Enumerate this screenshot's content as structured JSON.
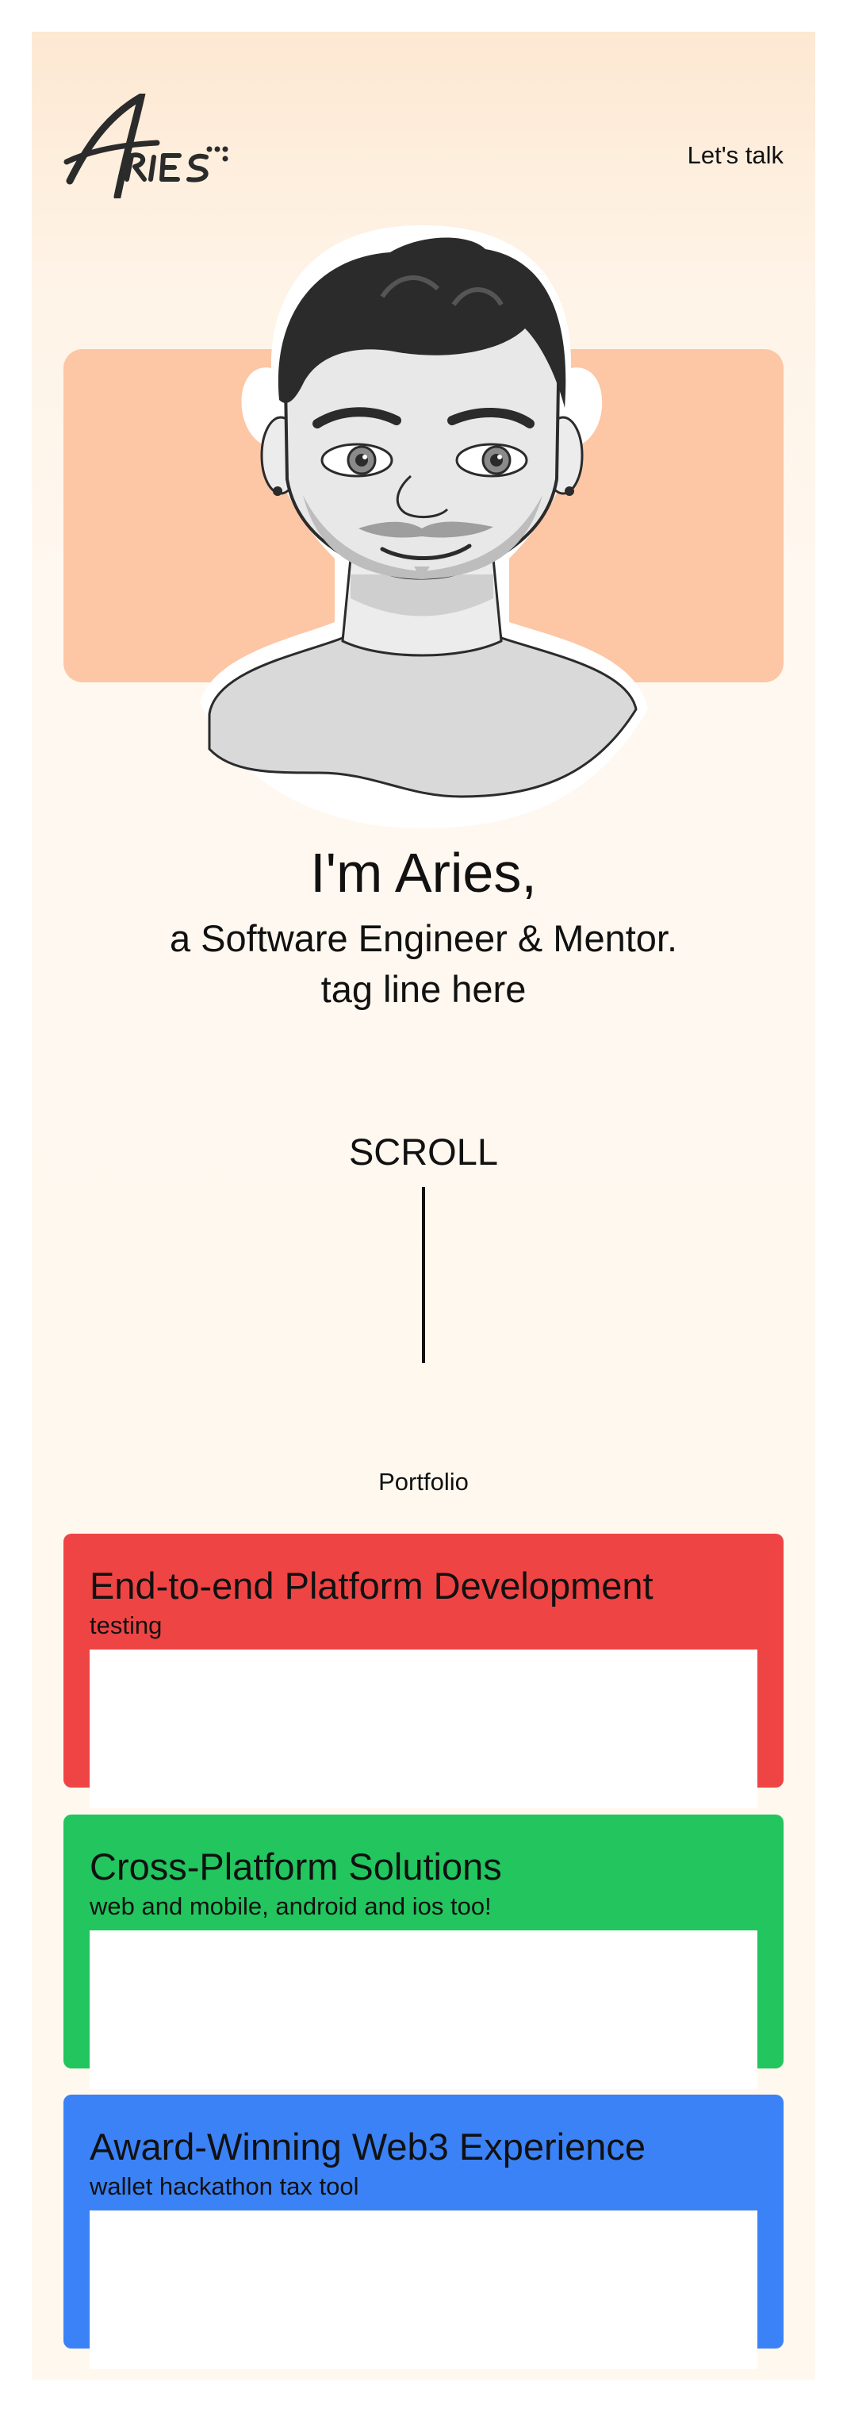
{
  "header": {
    "logo_text": "Aries",
    "cta_label": "Let's talk"
  },
  "hero": {
    "title": "I'm Aries,",
    "subtitle": "a Software Engineer & Mentor.",
    "tagline": "tag line here",
    "scroll_label": "SCROLL"
  },
  "portfolio": {
    "heading": "Portfolio",
    "cards": [
      {
        "title": "End-to-end Platform Development",
        "description": "testing",
        "color": "#ef4444"
      },
      {
        "title": "Cross-Platform Solutions",
        "description": "web and mobile, android and ios too!",
        "color": "#22c55e"
      },
      {
        "title": "Award-Winning Web3 Experience",
        "description": "wallet hackathon tax tool",
        "color": "#3b82f6"
      }
    ]
  },
  "colors": {
    "hero_accent": "#fdc6a4",
    "page_background_top": "#fde8d2",
    "page_background_bottom": "#fff8ee"
  }
}
